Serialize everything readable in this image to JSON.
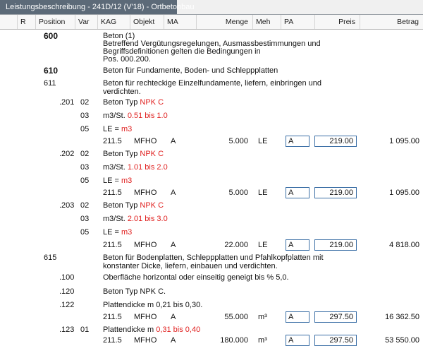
{
  "window": {
    "tab_title": "Leistungsbeschreibung - 241D/12 (V'18) - Ortbetonbau"
  },
  "columns": [
    "R",
    "Position",
    "Var",
    "KAG",
    "Objekt",
    "MA",
    "Menge",
    "Meh",
    "PA",
    "Preis",
    "Betrag"
  ],
  "rows": [
    {
      "position": "600",
      "pos_bold": true,
      "text": "Beton (1)"
    },
    {
      "text": "Betreffend Vergütungsregelungen, Ausmassbestimmungen und"
    },
    {
      "text": "Begriffsdefinitionen gelten die Bedingungen in"
    },
    {
      "text": "Pos. 000.200."
    },
    {
      "position": "610",
      "pos_bold": true,
      "text": "Beton für Fundamente, Boden- und Schleppplatten"
    },
    {
      "position": "611",
      "text": "Beton für rechteckige Einzelfundamente, liefern, einbringen und"
    },
    {
      "text": "verdichten."
    },
    {
      "sub": ".201",
      "var": "02",
      "text": "Beton Typ ",
      "text_red": "NPK C"
    },
    {
      "var": "03",
      "text": "m3/St. ",
      "text_red": "0.51 bis 1.0"
    },
    {
      "var": "05",
      "text": "LE = ",
      "text_red": "m3"
    },
    {
      "kag": "211.5",
      "objekt": "MFHO",
      "ma": "A",
      "menge": "5.000",
      "meh": "LE",
      "pa": "A",
      "preis": "219.00",
      "betrag": "1 095.00"
    },
    {
      "sub": ".202",
      "var": "02",
      "text": "Beton Typ ",
      "text_red": "NPK C"
    },
    {
      "var": "03",
      "text": "m3/St. ",
      "text_red": "1.01 bis 2.0"
    },
    {
      "var": "05",
      "text": "LE = ",
      "text_red": "m3"
    },
    {
      "kag": "211.5",
      "objekt": "MFHO",
      "ma": "A",
      "menge": "5.000",
      "meh": "LE",
      "pa": "A",
      "preis": "219.00",
      "betrag": "1 095.00"
    },
    {
      "sub": ".203",
      "var": "02",
      "text": "Beton Typ ",
      "text_red": "NPK C"
    },
    {
      "var": "03",
      "text": "m3/St. ",
      "text_red": "2.01 bis 3.0"
    },
    {
      "var": "05",
      "text": "LE = ",
      "text_red": "m3"
    },
    {
      "kag": "211.5",
      "objekt": "MFHO",
      "ma": "A",
      "menge": "22.000",
      "meh": "LE",
      "pa": "A",
      "preis": "219.00",
      "betrag": "4 818.00"
    },
    {
      "position": "615",
      "text": "Beton für Bodenplatten, Schleppplatten und Pfahlkopfplatten mit"
    },
    {
      "text": "konstanter Dicke, liefern, einbauen und verdichten."
    },
    {
      "sub": ".100",
      "text": "Oberfläche horizontal oder einseitig geneigt bis % 5,0."
    },
    {
      "sub": ".120",
      "text": "Beton Typ NPK C."
    },
    {
      "sub": ".122",
      "text": "Plattendicke m 0,21 bis 0,30."
    },
    {
      "kag": "211.5",
      "objekt": "MFHO",
      "ma": "A",
      "menge": "55.000",
      "meh": "m³",
      "pa": "A",
      "preis": "297.50",
      "betrag": "16 362.50"
    },
    {
      "sub": ".123",
      "var": "01",
      "text": "Plattendicke m ",
      "text_red": "0,31 bis 0,40"
    },
    {
      "kag": "211.5",
      "objekt": "MFHO",
      "ma": "A",
      "menge": "180.000",
      "meh": "m³",
      "pa": "A",
      "preis": "297.50",
      "betrag": "53 550.00"
    }
  ]
}
